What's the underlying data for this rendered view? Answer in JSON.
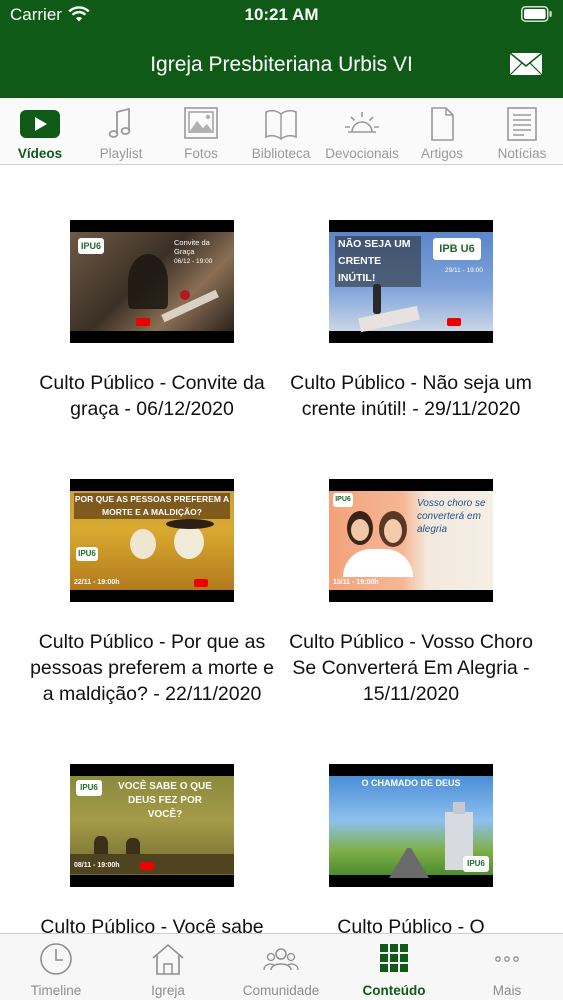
{
  "status_bar": {
    "carrier": "Carrier",
    "time": "10:21 AM"
  },
  "header": {
    "title": "Igreja Presbiteriana Urbis VI"
  },
  "colors": {
    "brand": "#0f5a16",
    "tab_inactive": "#9a9a9a",
    "background": "#ffffff"
  },
  "tabs": [
    {
      "label": "Vídeos",
      "icon": "play-icon",
      "active": true
    },
    {
      "label": "Playlist",
      "icon": "music-note-icon",
      "active": false
    },
    {
      "label": "Fotos",
      "icon": "photo-icon",
      "active": false
    },
    {
      "label": "Biblioteca",
      "icon": "book-icon",
      "active": false
    },
    {
      "label": "Devocionais",
      "icon": "sun-icon",
      "active": false
    },
    {
      "label": "Artigos",
      "icon": "document-icon",
      "active": false
    },
    {
      "label": "Notícias",
      "icon": "newspaper-icon",
      "active": false
    }
  ],
  "videos": [
    {
      "title": "Culto Público - Convite da graça - 06/12/2020",
      "thumb_text": "Convite da Graça",
      "thumb_date": "06/12 - 19:00"
    },
    {
      "title": "Culto Público - Não seja um crente inútil! - 29/11/2020",
      "thumb_text": "NÃO SEJA UM CRENTE INÚTIL!",
      "thumb_date": "29/11 - 19:00"
    },
    {
      "title": "Culto Público - Por que as pessoas preferem a morte e a maldição? - 22/11/2020",
      "thumb_text": "POR QUE AS PESSOAS PREFEREM A MORTE E A MALDIÇÃO?",
      "thumb_date": "22/11 - 19:00h"
    },
    {
      "title": "Culto Público - Vosso Choro Se Converterá Em Alegria - 15/11/2020",
      "thumb_text": "Vosso choro se converterá em alegria",
      "thumb_date": "15/11 - 19:00h"
    },
    {
      "title": "Culto Público - Você sabe",
      "thumb_text": "VOCÊ SABE O QUE DEUS FEZ POR VOCÊ?",
      "thumb_date": "08/11 - 19:00h"
    },
    {
      "title": "Culto Público - O",
      "thumb_text": "O CHAMADO DE DEUS",
      "thumb_date": ""
    }
  ],
  "bottom_tabs": [
    {
      "label": "Timeline",
      "icon": "clock-icon",
      "active": false
    },
    {
      "label": "Igreja",
      "icon": "church-icon",
      "active": false
    },
    {
      "label": "Comunidade",
      "icon": "community-icon",
      "active": false
    },
    {
      "label": "Conteúdo",
      "icon": "grid-icon",
      "active": true
    },
    {
      "label": "Mais",
      "icon": "more-icon",
      "active": false
    }
  ]
}
